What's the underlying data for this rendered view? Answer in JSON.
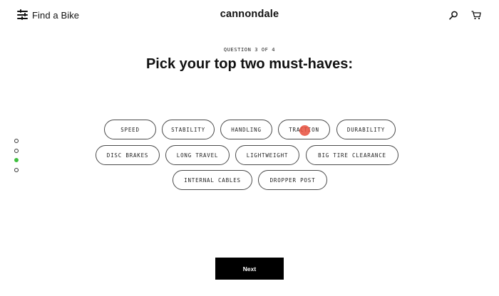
{
  "header": {
    "menu_icon": "menu-icon",
    "find_a_bike": "Find a Bike",
    "logo": "cannondale",
    "search_icon": "search-icon",
    "cart_icon": "cart-icon"
  },
  "progress": {
    "total": 4,
    "current": 3,
    "active_color": "#3fbf3f"
  },
  "question": {
    "label": "QUESTION 3 OF 4",
    "title": "Pick your top two must-haves:"
  },
  "options": [
    "SPEED",
    "STABILITY",
    "HANDLING",
    "TRACTION",
    "DURABILITY",
    "DISC BRAKES",
    "LONG TRAVEL",
    "LIGHTWEIGHT",
    "BIG TIRE CLEARANCE",
    "INTERNAL CABLES",
    "DROPPER POST"
  ],
  "next_label": "Next"
}
